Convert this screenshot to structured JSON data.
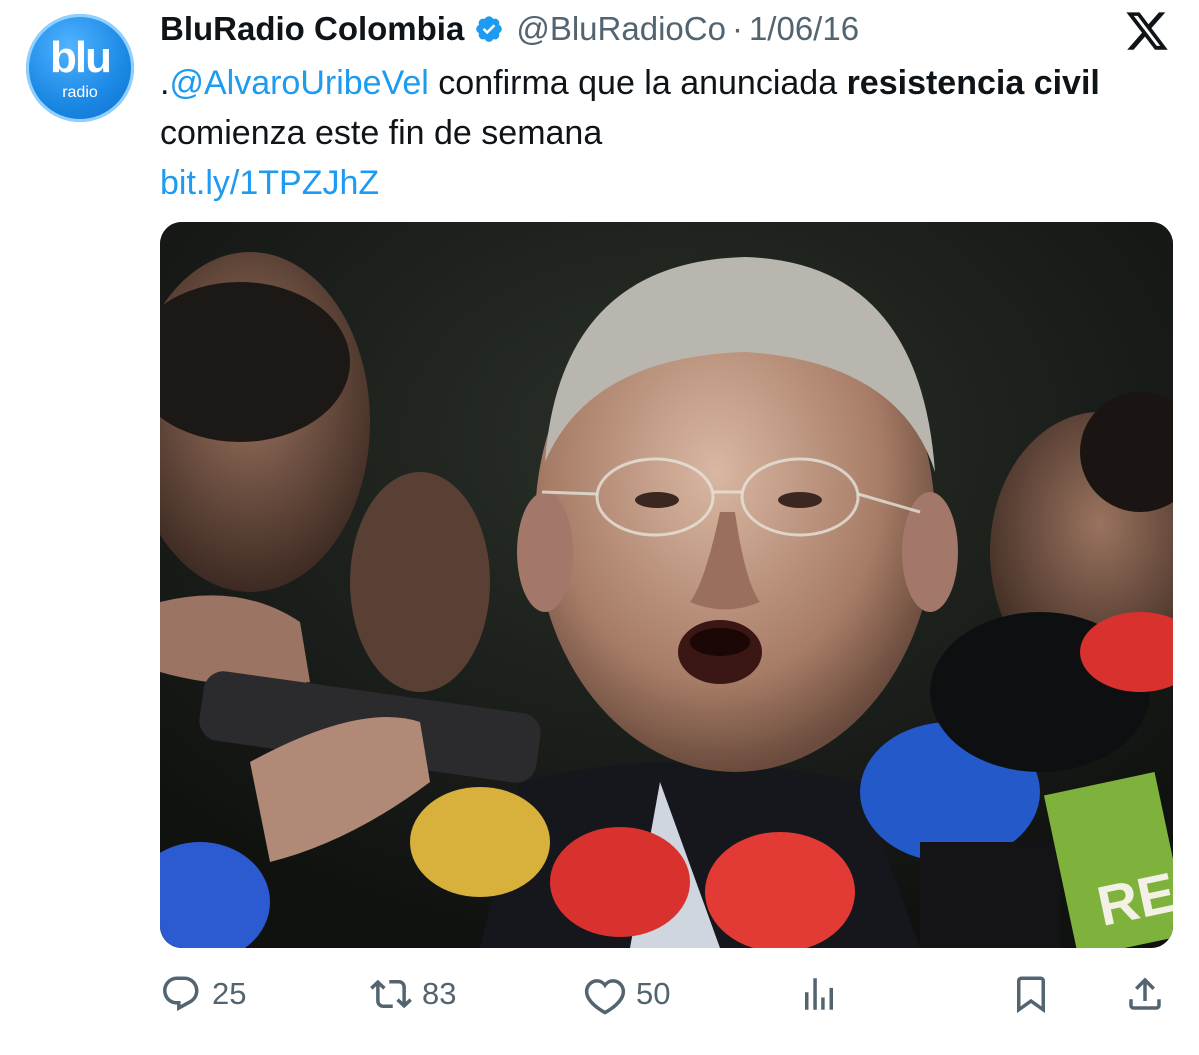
{
  "account": {
    "avatar_logo_main": "blu",
    "avatar_logo_sub": "radio",
    "display_name": "BluRadio Colombia",
    "verified_icon": "verified-badge-icon",
    "handle": "@BluRadioCo",
    "separator": "·",
    "date": "1/06/16"
  },
  "platform_icon": "x-logo-icon",
  "tweet": {
    "prefix": ".",
    "mention": "@AlvaroUribeVel",
    "text_before_bold": " confirma que la anunciada ",
    "bold_text": "resistencia civil",
    "text_after_bold": " comienza este fin de semana",
    "link": "bit.ly/1TPZJhZ"
  },
  "media": {
    "description_icon": "photo",
    "visible_text": "REC"
  },
  "actions": {
    "reply_count": "25",
    "retweet_count": "83",
    "like_count": "50",
    "reply_icon": "reply-icon",
    "retweet_icon": "retweet-icon",
    "like_icon": "heart-icon",
    "views_icon": "views-icon",
    "bookmark_icon": "bookmark-icon",
    "share_icon": "share-icon"
  },
  "colors": {
    "link": "#1d9bf0",
    "secondary_text": "#536471",
    "primary_text": "#0f1419",
    "verified": "#1d9bf0"
  }
}
